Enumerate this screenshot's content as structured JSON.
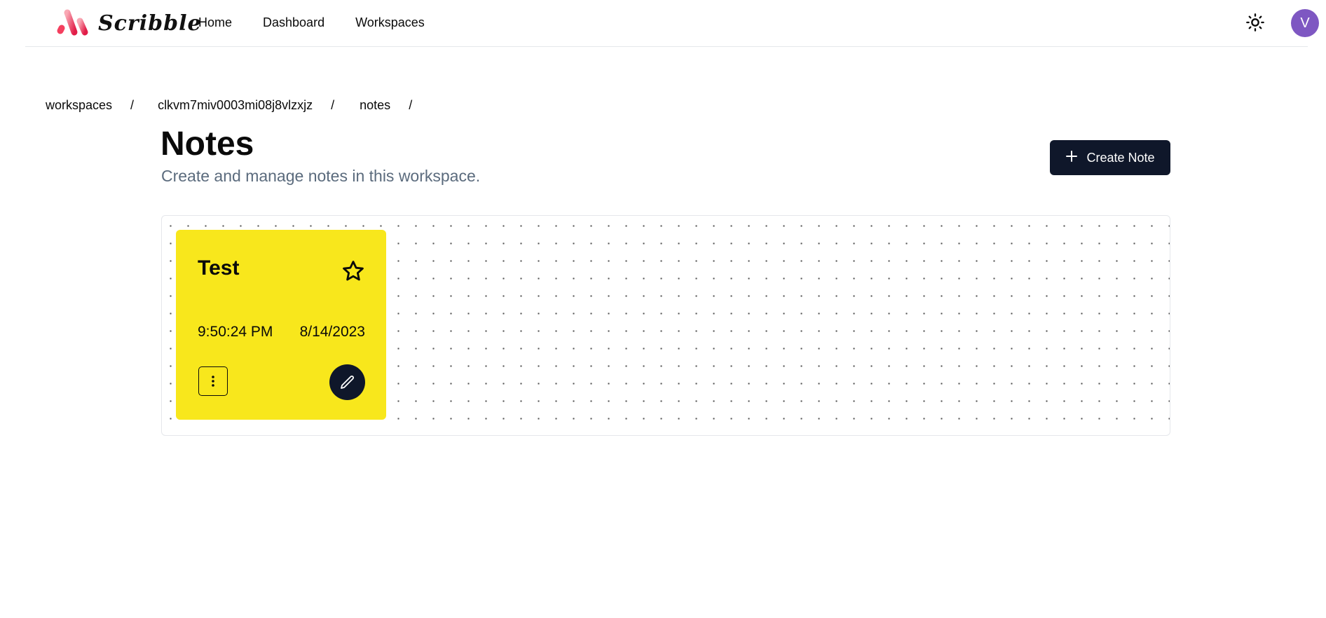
{
  "app": {
    "name": "Scribble",
    "brand_color": "#f43f5e",
    "accent_color": "#0f172a"
  },
  "nav": {
    "items": [
      {
        "label": "Home"
      },
      {
        "label": "Dashboard"
      },
      {
        "label": "Workspaces"
      }
    ]
  },
  "header": {
    "theme_icon": "sun-icon",
    "avatar_initial": "V",
    "avatar_color": "#7e57c2"
  },
  "breadcrumb": {
    "items": [
      {
        "label": "workspaces"
      },
      {
        "label": "clkvm7miv0003mi08j8vlzxjz"
      },
      {
        "label": "notes"
      }
    ],
    "separator": "/"
  },
  "page": {
    "title": "Notes",
    "subtitle": "Create and manage notes in this workspace.",
    "create_button_label": "Create Note",
    "create_button_icon": "plus-icon"
  },
  "notes": [
    {
      "title": "Test",
      "time": "9:50:24 PM",
      "date": "8/14/2023",
      "color": "#f8e71c",
      "starred": false,
      "star_icon": "star-outline-icon",
      "more_icon": "more-vertical-icon",
      "edit_icon": "pencil-icon"
    }
  ]
}
